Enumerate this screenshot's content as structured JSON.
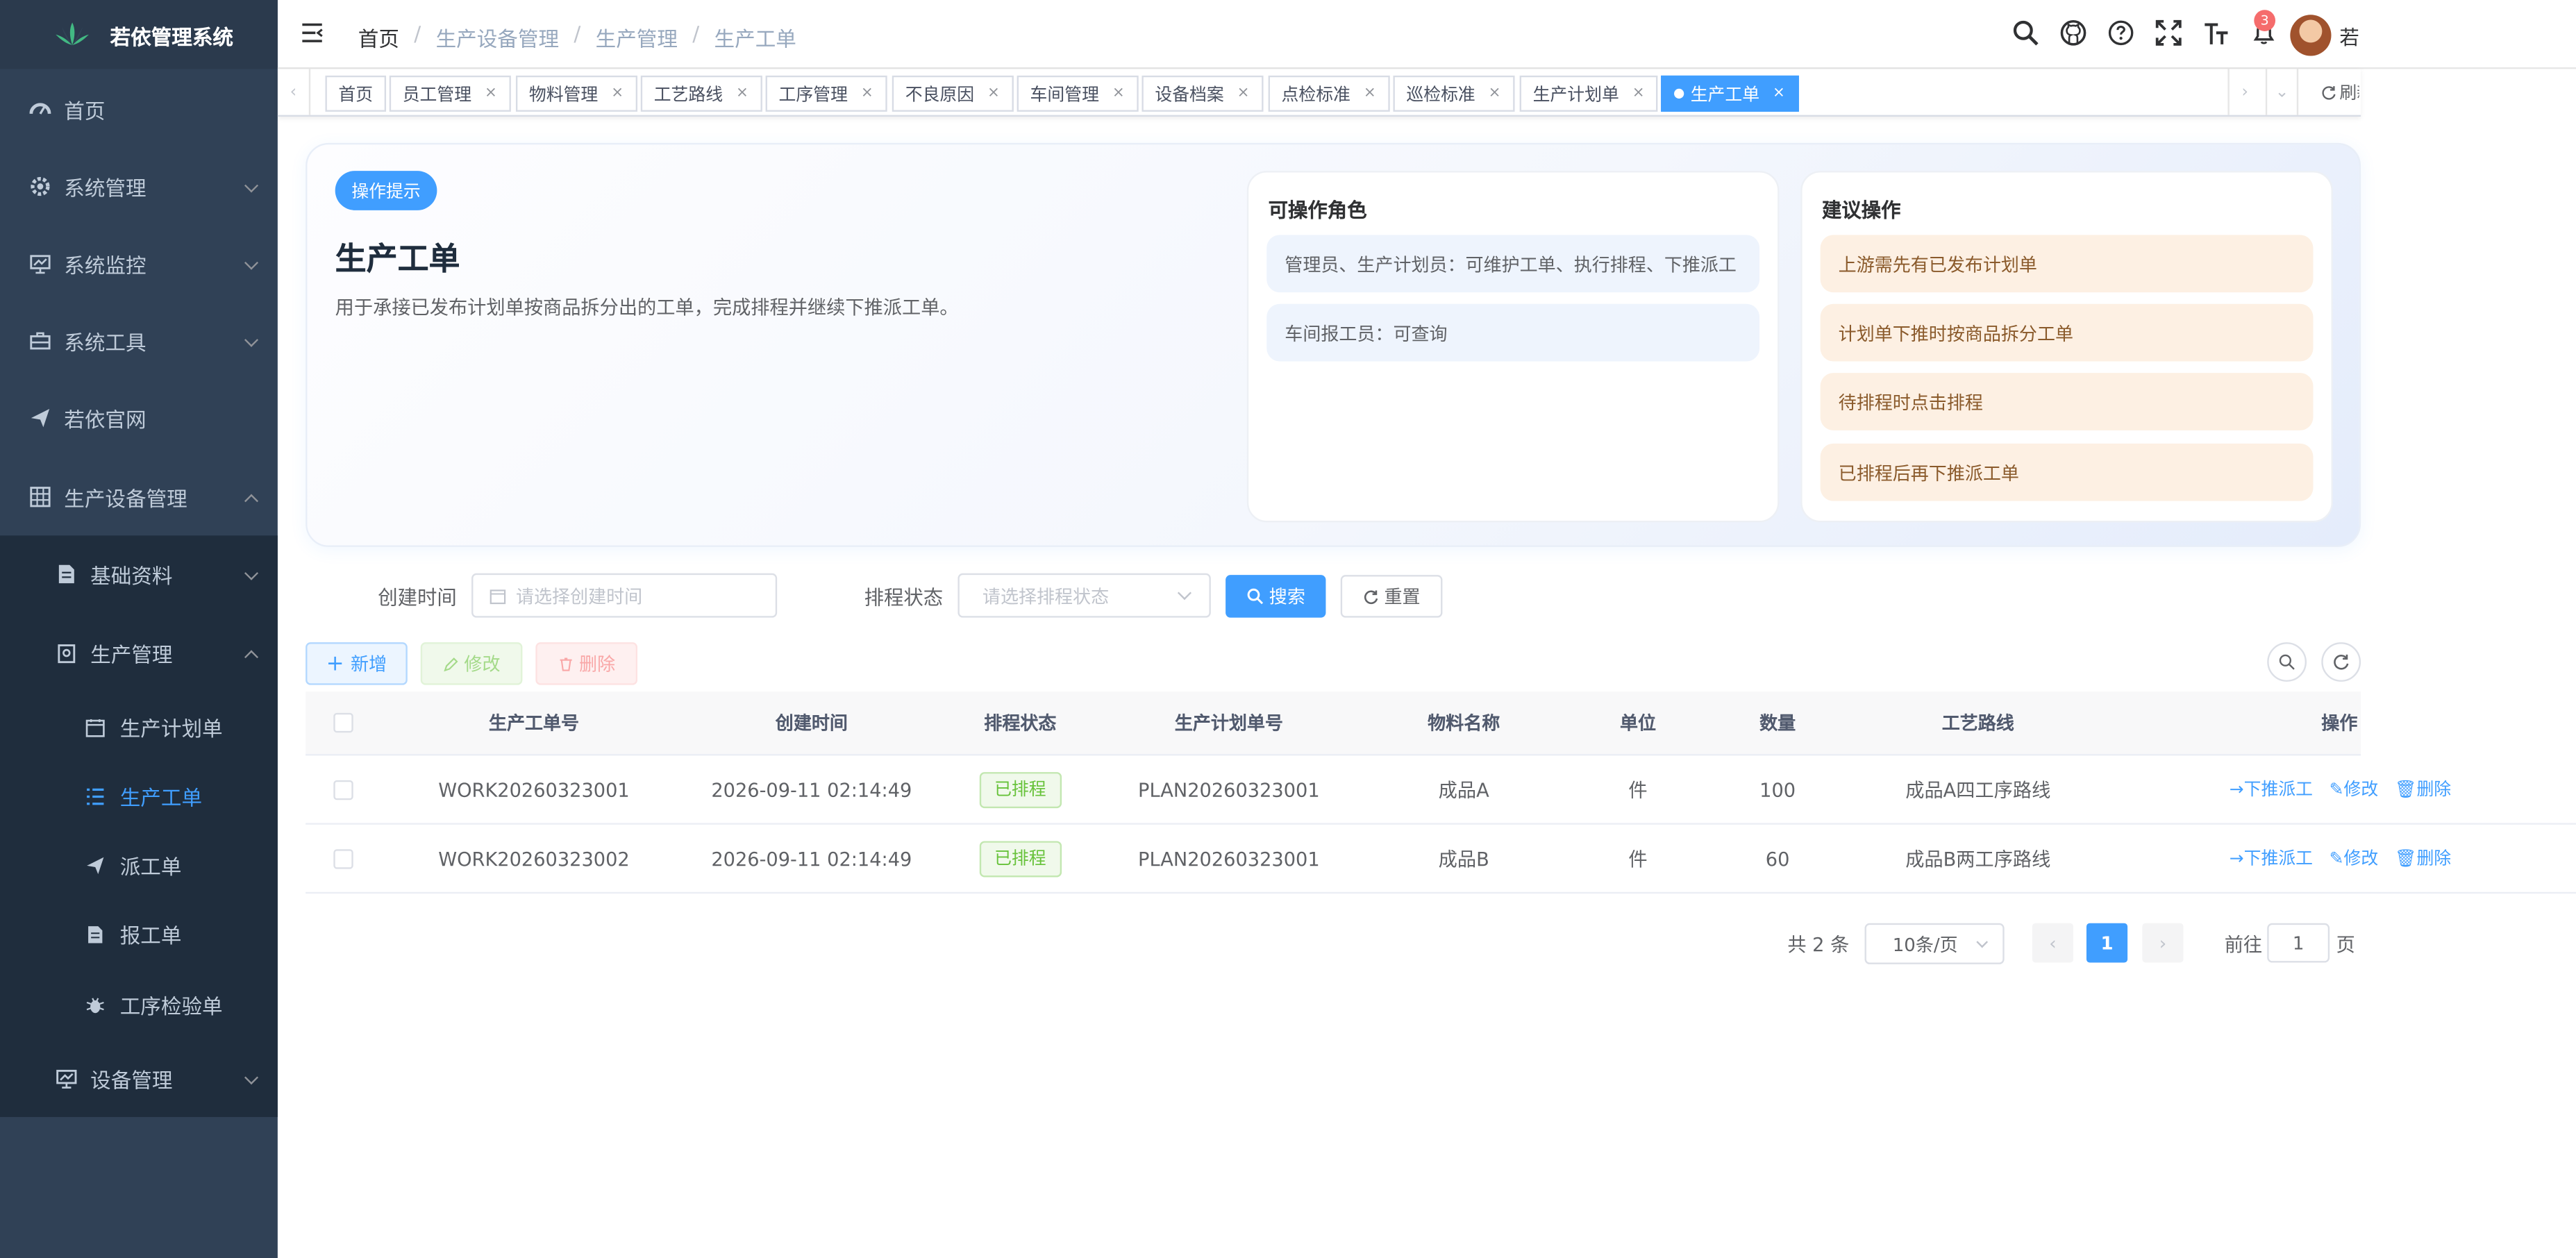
{
  "app": {
    "title": "若依管理系统"
  },
  "colors": {
    "primary": "#409eff",
    "sidebar": "#304156",
    "success": "#67c23a",
    "danger": "#f56c6c"
  },
  "sidebar": {
    "items": [
      {
        "label": "首页",
        "icon": "dashboard-icon"
      },
      {
        "label": "系统管理",
        "icon": "gear-icon"
      },
      {
        "label": "系统监控",
        "icon": "monitor-icon"
      },
      {
        "label": "系统工具",
        "icon": "toolbox-icon"
      },
      {
        "label": "若依官网",
        "icon": "paper-plane-icon"
      },
      {
        "label": "生产设备管理",
        "icon": "table-grid-icon"
      },
      {
        "label": "基础资料",
        "icon": "document-icon"
      },
      {
        "label": "生产管理",
        "icon": "clipboard-icon"
      },
      {
        "label": "生产计划单",
        "icon": "calendar-icon"
      },
      {
        "label": "生产工单",
        "icon": "list-icon"
      },
      {
        "label": "派工单",
        "icon": "paper-plane-icon"
      },
      {
        "label": "报工单",
        "icon": "document-icon"
      },
      {
        "label": "工序检验单",
        "icon": "bug-icon"
      },
      {
        "label": "设备管理",
        "icon": "monitor-icon"
      }
    ]
  },
  "navbar": {
    "breadcrumb": [
      "首页",
      "生产设备管理",
      "生产管理",
      "生产工单"
    ],
    "separator": "/",
    "notification_count": "3",
    "user_name": "若"
  },
  "tags": {
    "items": [
      "首页",
      "员工管理",
      "物料管理",
      "工艺路线",
      "工序管理",
      "不良原因",
      "车间管理",
      "设备档案",
      "点检标准",
      "巡检标准",
      "生产计划单",
      "生产工单"
    ],
    "active": "生产工单",
    "refresh_label": "刷新"
  },
  "hint": {
    "pill": "操作提示",
    "title": "生产工单",
    "description": "用于承接已发布计划单按商品拆分出的工单，完成排程并继续下推派工单。",
    "roles_title": "可操作角色",
    "roles": [
      "管理员、生产计划员：可维护工单、执行排程、下推派工",
      "车间报工员：可查询"
    ],
    "suggest_title": "建议操作",
    "suggestions": [
      "上游需先有已发布计划单",
      "计划单下推时按商品拆分工单",
      "待排程时点击排程",
      "已排程后再下推派工单"
    ]
  },
  "search": {
    "created_label": "创建时间",
    "created_placeholder": "请选择创建时间",
    "status_label": "排程状态",
    "status_placeholder": "请选择排程状态",
    "search_btn": "搜索",
    "reset_btn": "重置"
  },
  "toolbar": {
    "add": "新增",
    "edit": "修改",
    "delete": "删除"
  },
  "table": {
    "columns": [
      "生产工单号",
      "创建时间",
      "排程状态",
      "生产计划单号",
      "物料名称",
      "单位",
      "数量",
      "工艺路线",
      "操作"
    ],
    "rows": [
      {
        "no": "WORK20260323001",
        "created": "2026-09-11 02:14:49",
        "status": "已排程",
        "plan": "PLAN20260323001",
        "material": "成品A",
        "unit": "件",
        "qty": "100",
        "route": "成品A四工序路线"
      },
      {
        "no": "WORK20260323002",
        "created": "2026-09-11 02:14:49",
        "status": "已排程",
        "plan": "PLAN20260323001",
        "material": "成品B",
        "unit": "件",
        "qty": "60",
        "route": "成品B两工序路线"
      }
    ],
    "actions": {
      "push": "下推派工",
      "edit": "修改",
      "delete": "删除"
    }
  },
  "pagination": {
    "total": "共 2 条",
    "page_size": "10条/页",
    "current": "1",
    "goto_prefix": "前往",
    "goto_value": "1",
    "goto_suffix": "页"
  }
}
